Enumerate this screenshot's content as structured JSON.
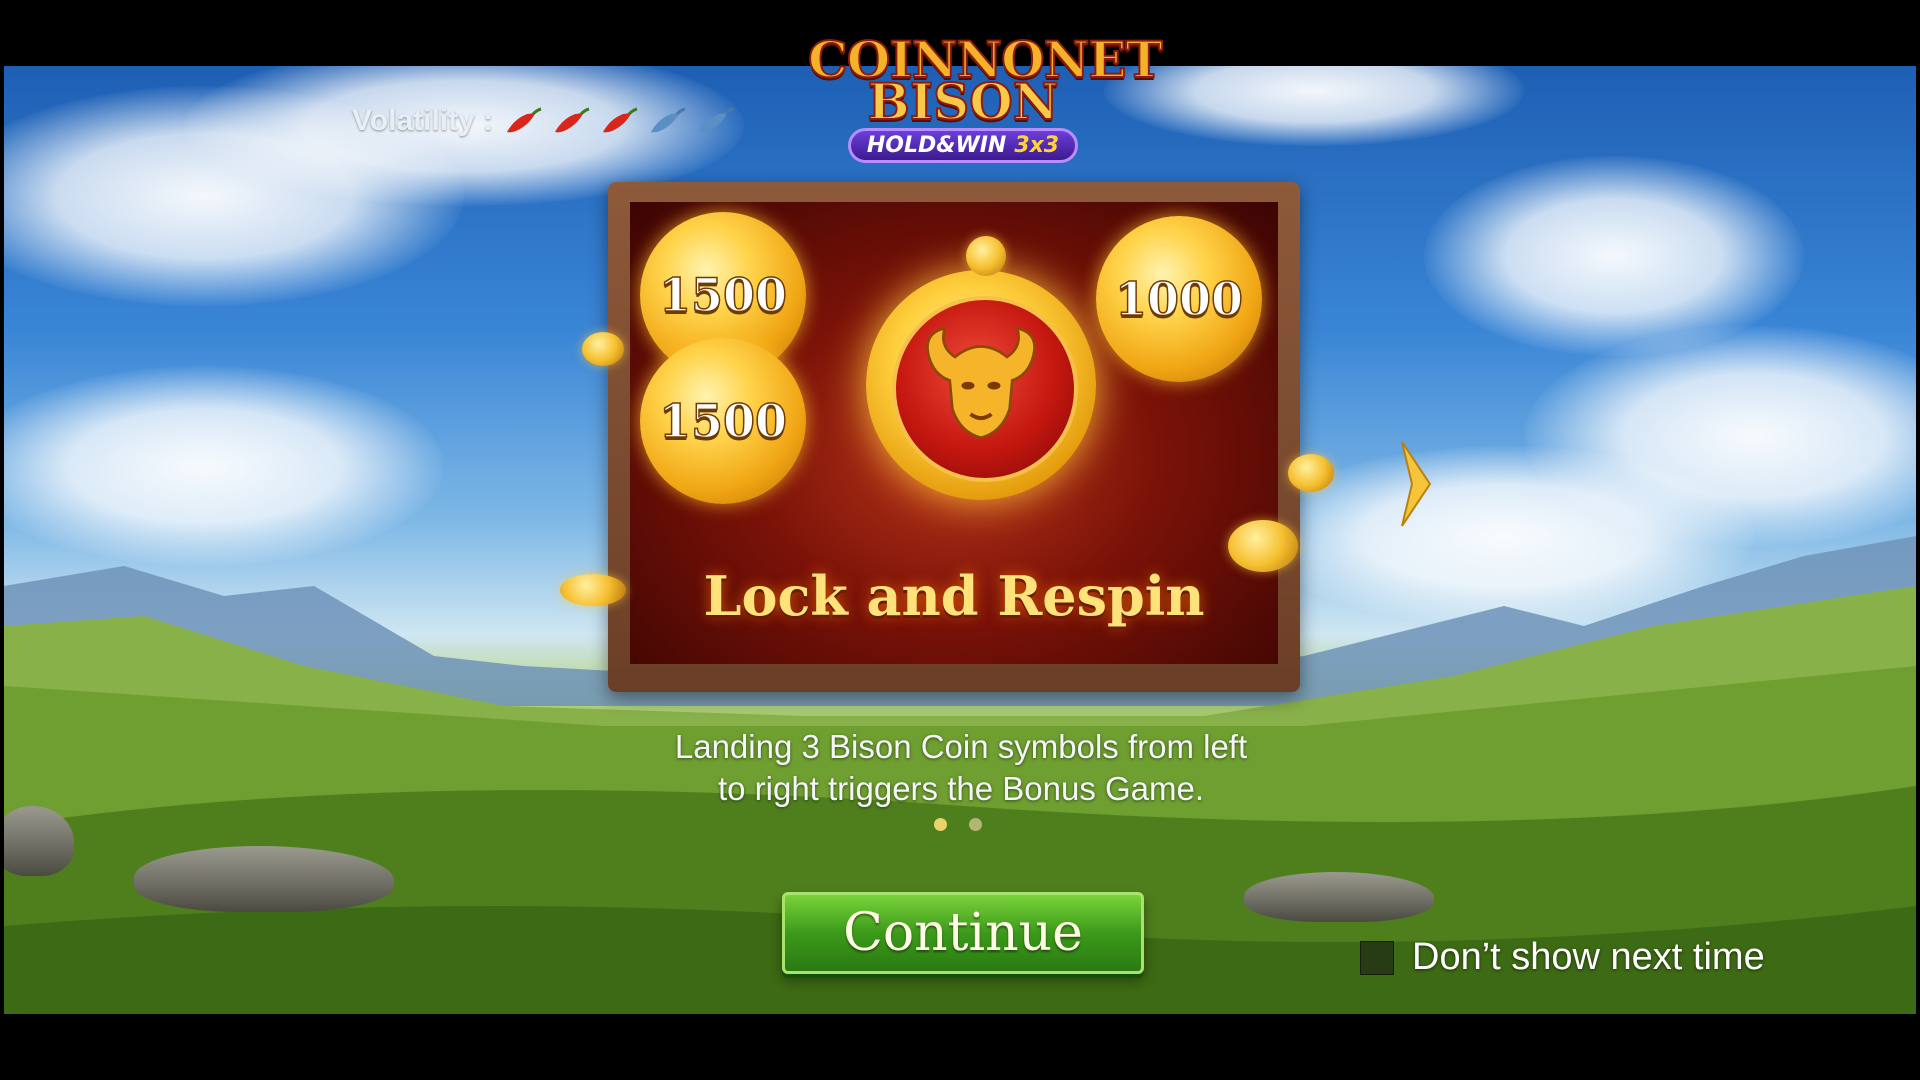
{
  "game": {
    "logo_line1": "COINNONET",
    "logo_line2": "BISON",
    "logo_badge": "HOLD&WIN",
    "logo_badge_grid": "3x3"
  },
  "volatility": {
    "label": "Volatility :",
    "level": 3,
    "max": 5
  },
  "feature": {
    "coin_values": [
      "1500",
      "1000",
      "1500"
    ],
    "title": "Lock and Respin",
    "description_line1": "Landing 3 Bison Coin symbols from left",
    "description_line2": "to right triggers the Bonus Game."
  },
  "pager": {
    "pages": 2,
    "current": 1
  },
  "buttons": {
    "continue_label": "Continue",
    "dont_show_label": "Don’t show next time"
  },
  "colors": {
    "accent_gold": "#ffd34a",
    "continue_green": "#3c9a1a",
    "pepper_active": "#d8261a",
    "pepper_inactive": "#5a8fc4"
  },
  "icons": [
    "chili-pepper-icon",
    "bison-head-icon",
    "chevron-right-icon",
    "checkbox-icon"
  ]
}
